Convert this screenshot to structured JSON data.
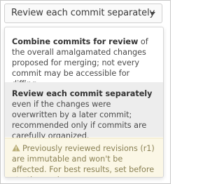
{
  "dropdown": {
    "selected_label": "Review each commit separately"
  },
  "options": [
    {
      "title": "Combine commits for review",
      "description": " of the overall amalgamated changes proposed for merging; not every commit may be accessible for diffing."
    },
    {
      "title": "Review each commit separately",
      "description": " even if the changes were overwritten by a later commit; recommended only if commits are carefully organized."
    }
  ],
  "notice": {
    "icon": "warning-icon",
    "text": "Previously reviewed revisions (r1) are immutable and won't be affected. For best results, set before starting review."
  },
  "colors": {
    "highlight_background": "#ededed",
    "notice_background": "#fbf7e6",
    "notice_text": "#8a8155"
  }
}
